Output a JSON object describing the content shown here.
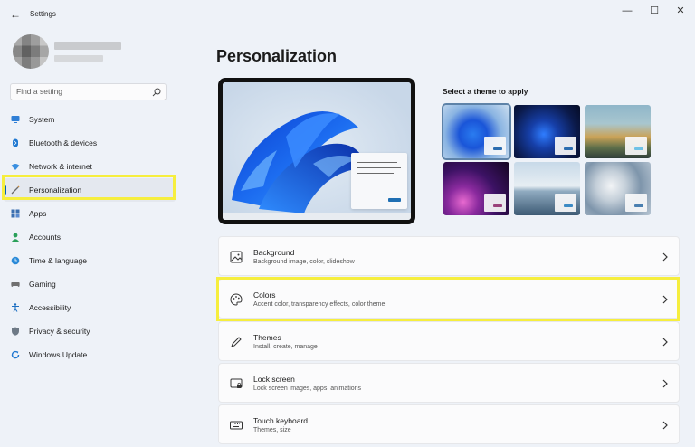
{
  "window": {
    "title": "Settings",
    "back_glyph": "←",
    "minimize_glyph": "—",
    "maximize_glyph": "☐",
    "close_glyph": "✕"
  },
  "search": {
    "placeholder": "Find a setting"
  },
  "sidebar": {
    "items": [
      {
        "label": "System",
        "icon": "monitor-icon"
      },
      {
        "label": "Bluetooth & devices",
        "icon": "bluetooth-icon"
      },
      {
        "label": "Network & internet",
        "icon": "wifi-icon"
      },
      {
        "label": "Personalization",
        "icon": "brush-icon",
        "active": true
      },
      {
        "label": "Apps",
        "icon": "apps-icon"
      },
      {
        "label": "Accounts",
        "icon": "person-icon"
      },
      {
        "label": "Time & language",
        "icon": "globe-clock-icon"
      },
      {
        "label": "Gaming",
        "icon": "controller-icon"
      },
      {
        "label": "Accessibility",
        "icon": "accessibility-icon"
      },
      {
        "label": "Privacy & security",
        "icon": "shield-icon"
      },
      {
        "label": "Windows Update",
        "icon": "update-icon"
      }
    ]
  },
  "main": {
    "title": "Personalization",
    "themes_label": "Select a theme to apply",
    "themes": [
      {
        "name": "windows-light",
        "accent": "#2b6cb0",
        "selected": true
      },
      {
        "name": "windows-dark",
        "accent": "#2b6cb0"
      },
      {
        "name": "glow-landscape",
        "accent": "#6ec2e6"
      },
      {
        "name": "captured-motion",
        "accent": "#9a3f7a"
      },
      {
        "name": "sunrise-lake",
        "accent": "#3b8ac4"
      },
      {
        "name": "flow",
        "accent": "#4a7fb0"
      }
    ],
    "cards": [
      {
        "title": "Background",
        "subtitle": "Background image, color, slideshow",
        "icon": "image-icon"
      },
      {
        "title": "Colors",
        "subtitle": "Accent color, transparency effects, color theme",
        "icon": "palette-icon"
      },
      {
        "title": "Themes",
        "subtitle": "Install, create, manage",
        "icon": "pen-icon"
      },
      {
        "title": "Lock screen",
        "subtitle": "Lock screen images, apps, animations",
        "icon": "lock-screen-icon"
      },
      {
        "title": "Touch keyboard",
        "subtitle": "Themes, size",
        "icon": "keyboard-icon"
      }
    ]
  },
  "colors": {
    "accent": "#005fb8",
    "highlight": "#f6ee3e",
    "background": "#eef2f8"
  }
}
